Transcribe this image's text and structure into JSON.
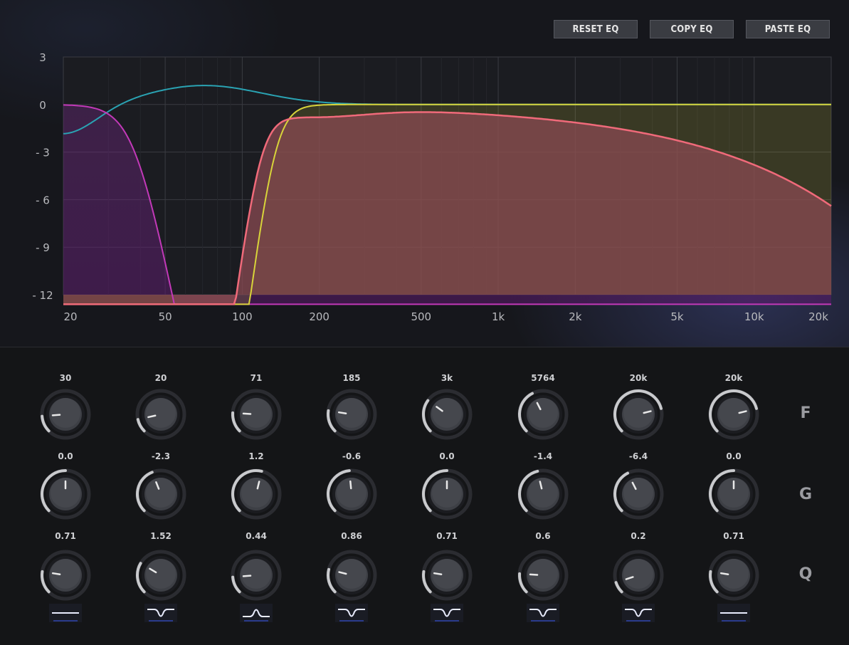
{
  "toolbar": {
    "reset_label": "RESET EQ",
    "copy_label": "COPY EQ",
    "paste_label": "PASTE EQ"
  },
  "graph": {
    "y_ticks": [
      "3",
      "0",
      "-3",
      "-6",
      "-9",
      "-12"
    ],
    "x_ticks": [
      "20",
      "50",
      "100",
      "200",
      "500",
      "1k",
      "2k",
      "5k",
      "10k",
      "20k"
    ],
    "colors": {
      "background": "#16171c",
      "grid": "#3a3b42",
      "band_teal": "#2aa3b3",
      "band_magenta": "#c239b8",
      "band_yellow": "#d8d43a",
      "sum_curve": "#f06a7a",
      "sum_fill": "#8a4a52"
    }
  },
  "row_labels": {
    "freq": "F",
    "gain": "G",
    "q": "Q"
  },
  "bands": [
    {
      "freq": "30",
      "gain": "0.0",
      "q": "0.71",
      "filter_icon": "flat-shelf-icon",
      "f_level": 0.15,
      "g_level": 0.5,
      "q_level": 0.2
    },
    {
      "freq": "20",
      "gain": "-2.3",
      "q": "1.52",
      "filter_icon": "notch-icon",
      "f_level": 0.12,
      "g_level": 0.42,
      "q_level": 0.28
    },
    {
      "freq": "71",
      "gain": "1.2",
      "q": "0.44",
      "filter_icon": "bell-peak-icon",
      "f_level": 0.18,
      "g_level": 0.55,
      "q_level": 0.15
    },
    {
      "freq": "185",
      "gain": "-0.6",
      "q": "0.86",
      "filter_icon": "notch-icon",
      "f_level": 0.2,
      "g_level": 0.48,
      "q_level": 0.22
    },
    {
      "freq": "3k",
      "gain": "0.0",
      "q": "0.71",
      "filter_icon": "notch-icon",
      "f_level": 0.3,
      "g_level": 0.5,
      "q_level": 0.2
    },
    {
      "freq": "5764",
      "gain": "-1.4",
      "q": "0.6",
      "filter_icon": "notch-icon",
      "f_level": 0.4,
      "g_level": 0.45,
      "q_level": 0.18
    },
    {
      "freq": "20k",
      "gain": "-6.4",
      "q": "0.2",
      "filter_icon": "notch-icon",
      "f_level": 0.78,
      "g_level": 0.4,
      "q_level": 0.1
    },
    {
      "freq": "20k",
      "gain": "0.0",
      "q": "0.71",
      "filter_icon": "flat-shelf-icon",
      "f_level": 0.78,
      "g_level": 0.5,
      "q_level": 0.2
    }
  ]
}
